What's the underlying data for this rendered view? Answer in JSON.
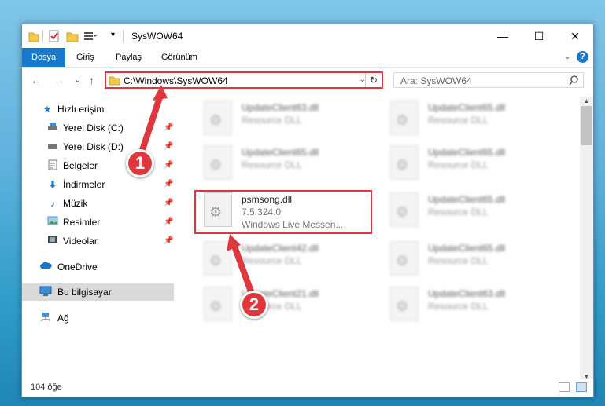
{
  "window": {
    "title": "SysWOW64",
    "controls": {
      "minimize": "—",
      "maximize": "☐",
      "close": "✕"
    }
  },
  "ribbon": {
    "tabs": [
      "Dosya",
      "Giriş",
      "Paylaş",
      "Görünüm"
    ],
    "help": "?",
    "collapse": "⌄"
  },
  "nav": {
    "back": "←",
    "forward": "→",
    "recent": "⌄",
    "up": "↑",
    "address": "C:\\Windows\\SysWOW64",
    "address_dropdown": "⌄",
    "refresh": "↻",
    "search_placeholder": "Ara: SysWOW64"
  },
  "sidebar": {
    "items": [
      {
        "label": "Hızlı erişim",
        "icon": "star-icon",
        "pinned": false
      },
      {
        "label": "Yerel Disk (C:)",
        "icon": "drive-icon",
        "pinned": true
      },
      {
        "label": "Yerel Disk (D:)",
        "icon": "drive-icon",
        "pinned": true
      },
      {
        "label": "Belgeler",
        "icon": "documents-icon",
        "pinned": true
      },
      {
        "label": "İndirmeler",
        "icon": "download-icon",
        "pinned": true
      },
      {
        "label": "Müzik",
        "icon": "music-icon",
        "pinned": true
      },
      {
        "label": "Resimler",
        "icon": "pictures-icon",
        "pinned": true
      },
      {
        "label": "Videolar",
        "icon": "video-icon",
        "pinned": true
      },
      {
        "label": "OneDrive",
        "icon": "cloud-icon",
        "pinned": false
      },
      {
        "label": "Bu bilgisayar",
        "icon": "computer-icon",
        "pinned": false
      },
      {
        "label": "Ağ",
        "icon": "network-icon",
        "pinned": false
      }
    ]
  },
  "files": {
    "left": [
      {
        "name": "UpdateClient63.dll",
        "desc": "Resource DLL"
      },
      {
        "name": "UpdateClient65.dll",
        "desc": "Resource DLL"
      },
      {
        "name": "psmsong.dll",
        "desc": "7.5.324.0",
        "desc2": "Windows Live Messen..."
      },
      {
        "name": "UpdateClient42.dll",
        "desc": "Resource DLL"
      },
      {
        "name": "UpdateClient21.dll",
        "desc": "Resource DLL"
      }
    ],
    "right": [
      {
        "name": "UpdateClient65.dll",
        "desc": "Resource DLL"
      },
      {
        "name": "UpdateClient65.dll",
        "desc": "Resource DLL"
      },
      {
        "name": "UpdateClient65.dll",
        "desc": "Resource DLL"
      },
      {
        "name": "UpdateClient65.dll",
        "desc": "Resource DLL"
      },
      {
        "name": "UpdateClient63.dll",
        "desc": "Resource DLL"
      }
    ]
  },
  "status": {
    "count": "104 öğe"
  },
  "callouts": {
    "one": "1",
    "two": "2"
  },
  "colors": {
    "accent": "#1979ca",
    "callout": "#e0373d"
  }
}
